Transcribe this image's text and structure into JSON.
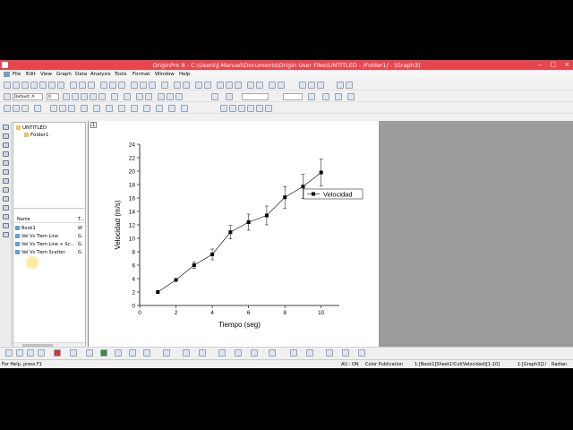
{
  "window": {
    "title": "OriginPro 8 - C:\\Users\\J.Manuel\\Documents\\Origin User Files\\UNTITLED - /Folder1/ - [Graph3]",
    "minimize": "–",
    "maximize": "□",
    "close": "×"
  },
  "menu": [
    "File",
    "Edit",
    "View",
    "Graph",
    "Data",
    "Analysis",
    "Tools",
    "Format",
    "Window",
    "Help"
  ],
  "toolbar": {
    "font_combo": "Default: A",
    "size_combo": "0"
  },
  "explorer": {
    "tree": {
      "root": "UNTITLED",
      "folder": "Folder1"
    },
    "columns": {
      "name": "Name",
      "type": "T..."
    },
    "items": [
      {
        "name": "Book1",
        "type": "W"
      },
      {
        "name": "Vel Vs Tiem Line",
        "type": "G."
      },
      {
        "name": "Vel Vs Tiem Line + Sc...",
        "type": "G."
      },
      {
        "name": "Vel Vs Tiem Scatter",
        "type": "G."
      }
    ]
  },
  "graph": {
    "layer_tab": "1"
  },
  "chart_data": {
    "type": "line",
    "xlabel": "Tiempo (seg)",
    "ylabel": "Velocidad (m/s)",
    "xlim": [
      0,
      11
    ],
    "ylim": [
      0,
      24
    ],
    "xticks": [
      0,
      2,
      4,
      6,
      8,
      10
    ],
    "yticks": [
      0,
      2,
      4,
      6,
      8,
      10,
      12,
      14,
      16,
      18,
      20,
      22,
      24
    ],
    "grid": false,
    "legend_position": "top-right",
    "series": [
      {
        "name": "Velocidad",
        "marker": "square",
        "color": "#000000",
        "x": [
          1,
          2,
          3,
          4,
          5,
          6,
          7,
          8,
          9,
          10
        ],
        "y": [
          2.0,
          3.8,
          6.0,
          7.6,
          10.9,
          12.4,
          13.4,
          16.1,
          17.7,
          19.8
        ],
        "error": [
          0,
          0,
          0.5,
          0.8,
          1.0,
          1.2,
          1.4,
          1.6,
          1.8,
          2.0
        ]
      }
    ]
  },
  "status": {
    "help": "For Help, press F1",
    "au": "AU : ON",
    "color": "Color Publication",
    "book": "1:[Book1]Sheet1!Col(Velocidad)[1:10]",
    "graph": "1:[Graph3]1!",
    "angle": "Radian"
  }
}
